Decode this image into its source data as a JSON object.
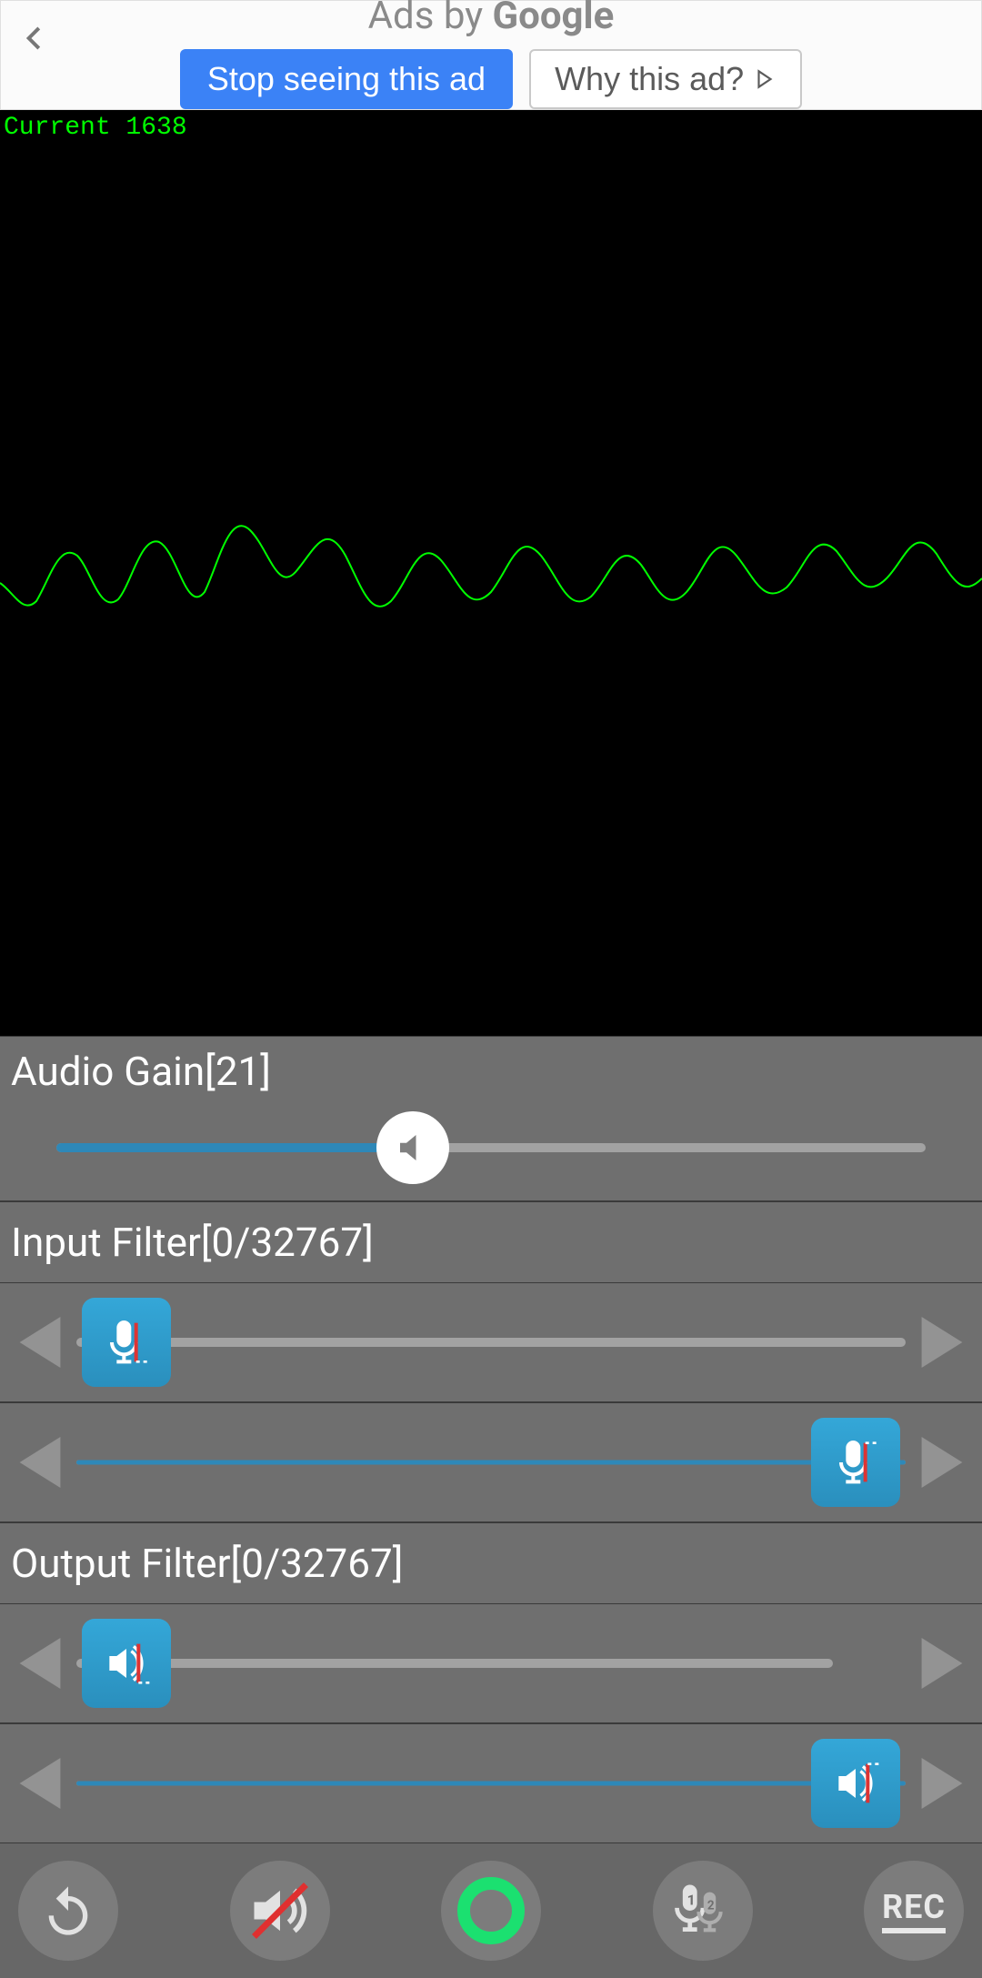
{
  "ad": {
    "title_prefix": "Ads by ",
    "title_brand": "Google",
    "stop_label": "Stop seeing this ad",
    "why_label": "Why this ad?"
  },
  "waveform": {
    "label": "Current 1638"
  },
  "gain": {
    "label": "Audio Gain[21]",
    "value_percent": 41
  },
  "input_filter": {
    "label": "Input Filter[0/32767]",
    "low_percent": 0,
    "high_percent": 100
  },
  "output_filter": {
    "label": "Output Filter[0/32767]",
    "low_percent": 0,
    "high_percent": 100
  },
  "bottom": {
    "rec_label": "REC"
  },
  "chart_data": {
    "type": "line",
    "title": "",
    "xlabel": "",
    "ylabel": "",
    "current_value": 1638,
    "ylim": [
      -32768,
      32767
    ],
    "note": "real-time audio amplitude oscilloscope trace"
  }
}
